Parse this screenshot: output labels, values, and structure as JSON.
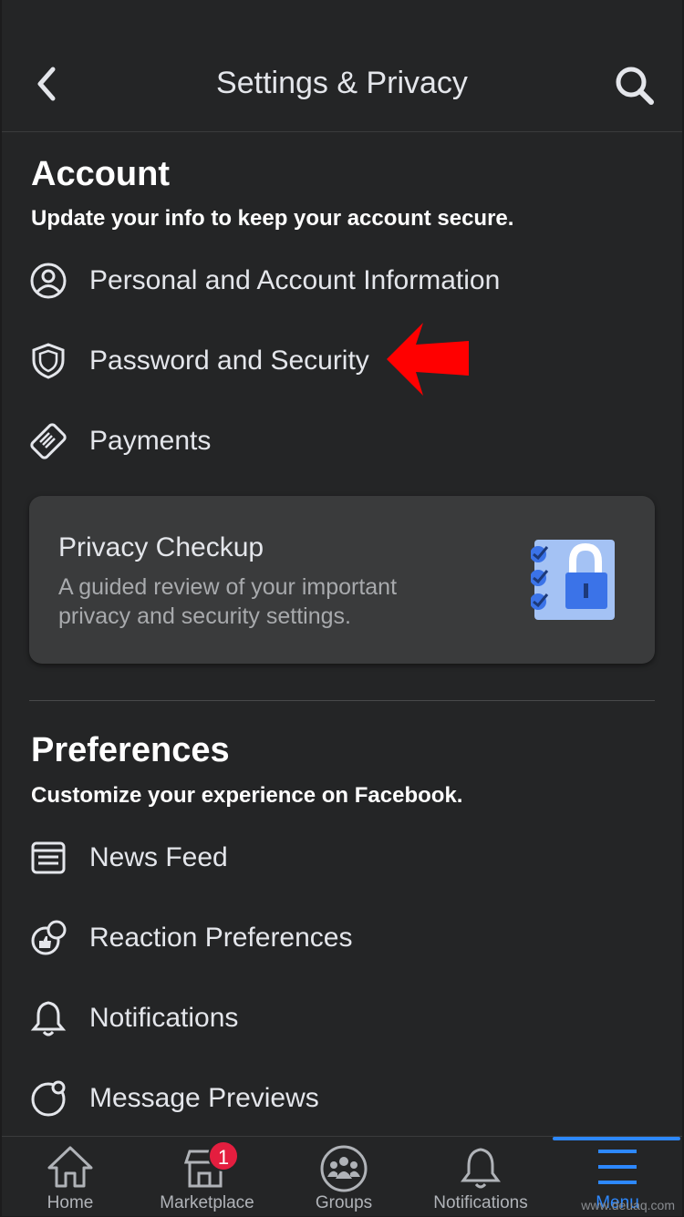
{
  "header": {
    "title": "Settings & Privacy",
    "back_icon": "chevron-left-icon",
    "search_icon": "search-icon"
  },
  "account": {
    "title": "Account",
    "subtitle": "Update your info to keep your account secure.",
    "items": [
      {
        "label": "Personal and Account Information",
        "icon": "user-circle-icon"
      },
      {
        "label": "Password and Security",
        "icon": "shield-icon"
      },
      {
        "label": "Payments",
        "icon": "card-icon"
      }
    ]
  },
  "annotation": {
    "color": "#ff0000",
    "points_to": "Password and Security"
  },
  "privacy_checkup": {
    "title": "Privacy Checkup",
    "description": "A guided review of your important privacy and security settings.",
    "icon": "checklist-lock-icon"
  },
  "preferences": {
    "title": "Preferences",
    "subtitle": "Customize your experience on Facebook.",
    "items": [
      {
        "label": "News Feed",
        "icon": "news-feed-icon"
      },
      {
        "label": "Reaction Preferences",
        "icon": "reaction-icon"
      },
      {
        "label": "Notifications",
        "icon": "bell-icon"
      },
      {
        "label": "Message Previews",
        "icon": "message-preview-icon"
      }
    ]
  },
  "tabbar": {
    "tabs": [
      {
        "label": "Home"
      },
      {
        "label": "Marketplace",
        "badge": "1"
      },
      {
        "label": "Groups"
      },
      {
        "label": "Notifications"
      },
      {
        "label": "Menu",
        "active": true
      }
    ],
    "accent": "#2d88ff"
  },
  "watermark": "www.deuaq.com"
}
